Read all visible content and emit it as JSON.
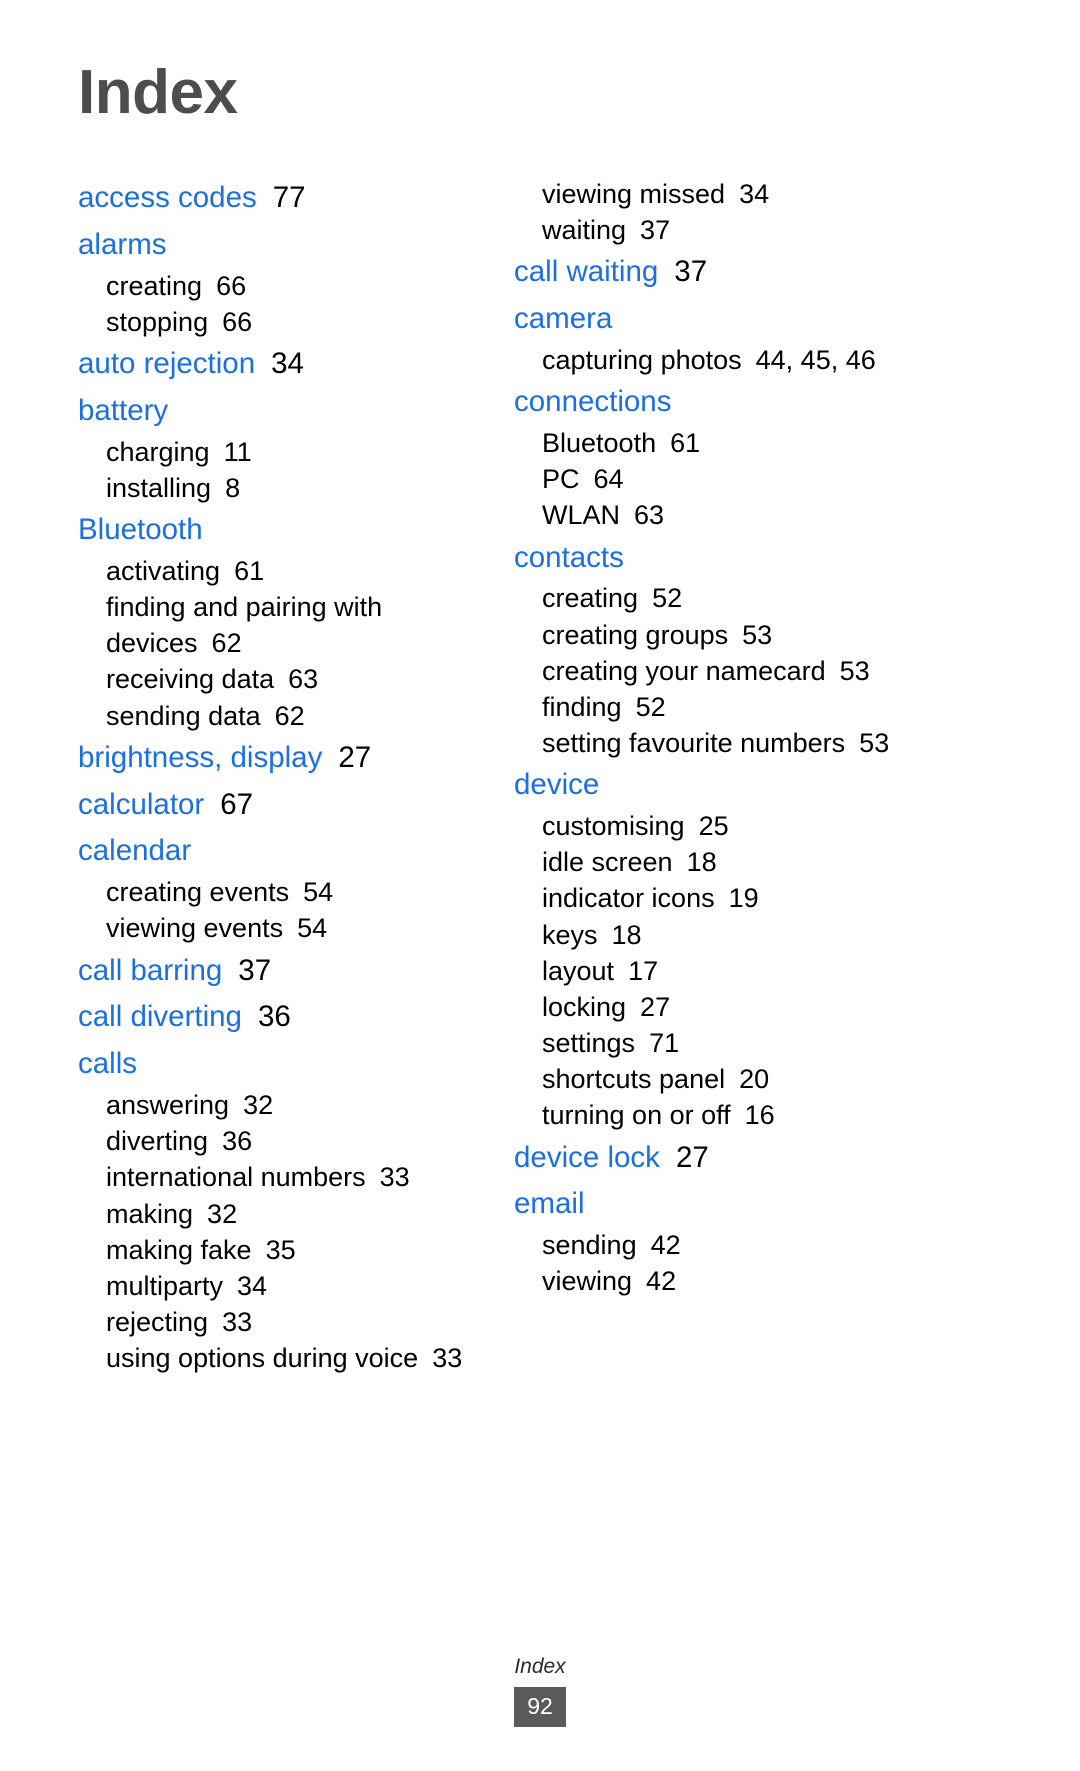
{
  "document": {
    "title": "Index",
    "footer_label": "Index",
    "page_number": "92"
  },
  "colors": {
    "entry_blue": "#1a6fe8",
    "title_gray": "#4d4d4d",
    "badge_gray": "#5a5a5a",
    "text_black": "#000000"
  },
  "columns": [
    {
      "name": "left-column",
      "groups": [
        {
          "heading": "access codes",
          "heading_pages": "77",
          "subentries": []
        },
        {
          "heading": "alarms",
          "heading_pages": "",
          "subentries": [
            {
              "label": "creating",
              "pages": "66"
            },
            {
              "label": "stopping",
              "pages": "66"
            }
          ]
        },
        {
          "heading": "auto rejection",
          "heading_pages": "34",
          "subentries": []
        },
        {
          "heading": "battery",
          "heading_pages": "",
          "subentries": [
            {
              "label": "charging",
              "pages": "11"
            },
            {
              "label": "installing",
              "pages": "8"
            }
          ]
        },
        {
          "heading": "Bluetooth",
          "heading_pages": "",
          "subentries": [
            {
              "label": "activating",
              "pages": "61"
            },
            {
              "label": "finding and pairing with devices",
              "pages": "62",
              "wrap": true
            },
            {
              "label": "receiving data",
              "pages": "63"
            },
            {
              "label": "sending data",
              "pages": "62"
            }
          ]
        },
        {
          "heading": "brightness, display",
          "heading_pages": "27",
          "subentries": []
        },
        {
          "heading": "calculator",
          "heading_pages": "67",
          "subentries": []
        },
        {
          "heading": "calendar",
          "heading_pages": "",
          "subentries": [
            {
              "label": "creating events",
              "pages": "54"
            },
            {
              "label": "viewing events",
              "pages": "54"
            }
          ]
        },
        {
          "heading": "call barring",
          "heading_pages": "37",
          "subentries": []
        },
        {
          "heading": "call diverting",
          "heading_pages": "36",
          "subentries": []
        },
        {
          "heading": "calls",
          "heading_pages": "",
          "subentries": [
            {
              "label": "answering",
              "pages": "32"
            },
            {
              "label": "diverting",
              "pages": "36"
            },
            {
              "label": "international numbers",
              "pages": "33"
            },
            {
              "label": "making",
              "pages": "32"
            },
            {
              "label": "making fake",
              "pages": "35"
            },
            {
              "label": "multiparty",
              "pages": "34"
            },
            {
              "label": "rejecting",
              "pages": "33"
            },
            {
              "label": "using options during voice",
              "pages": "33",
              "wrap": true
            }
          ]
        }
      ]
    },
    {
      "name": "right-column",
      "groups": [
        {
          "heading": "",
          "heading_pages": "",
          "subentries": [
            {
              "label": "viewing missed",
              "pages": "34"
            },
            {
              "label": "waiting",
              "pages": "37"
            }
          ]
        },
        {
          "heading": "call waiting",
          "heading_pages": "37",
          "subentries": []
        },
        {
          "heading": "camera",
          "heading_pages": "",
          "subentries": [
            {
              "label": "capturing photos",
              "pages": "44, 45, 46"
            }
          ]
        },
        {
          "heading": "connections",
          "heading_pages": "",
          "subentries": [
            {
              "label": "Bluetooth",
              "pages": "61"
            },
            {
              "label": "PC",
              "pages": "64"
            },
            {
              "label": "WLAN",
              "pages": "63"
            }
          ]
        },
        {
          "heading": "contacts",
          "heading_pages": "",
          "subentries": [
            {
              "label": "creating",
              "pages": "52"
            },
            {
              "label": "creating groups",
              "pages": "53"
            },
            {
              "label": "creating your namecard",
              "pages": "53"
            },
            {
              "label": "finding",
              "pages": "52"
            },
            {
              "label": "setting favourite numbers",
              "pages": "53",
              "wrap": true
            }
          ]
        },
        {
          "heading": "device",
          "heading_pages": "",
          "subentries": [
            {
              "label": "customising",
              "pages": "25"
            },
            {
              "label": "idle screen",
              "pages": "18"
            },
            {
              "label": "indicator icons",
              "pages": "19"
            },
            {
              "label": "keys",
              "pages": "18"
            },
            {
              "label": "layout",
              "pages": "17"
            },
            {
              "label": "locking",
              "pages": "27"
            },
            {
              "label": "settings",
              "pages": "71"
            },
            {
              "label": "shortcuts panel",
              "pages": "20"
            },
            {
              "label": "turning on or off",
              "pages": "16"
            }
          ]
        },
        {
          "heading": "device lock",
          "heading_pages": "27",
          "subentries": []
        },
        {
          "heading": "email",
          "heading_pages": "",
          "subentries": [
            {
              "label": "sending",
              "pages": "42"
            },
            {
              "label": "viewing",
              "pages": "42"
            }
          ]
        }
      ]
    }
  ]
}
